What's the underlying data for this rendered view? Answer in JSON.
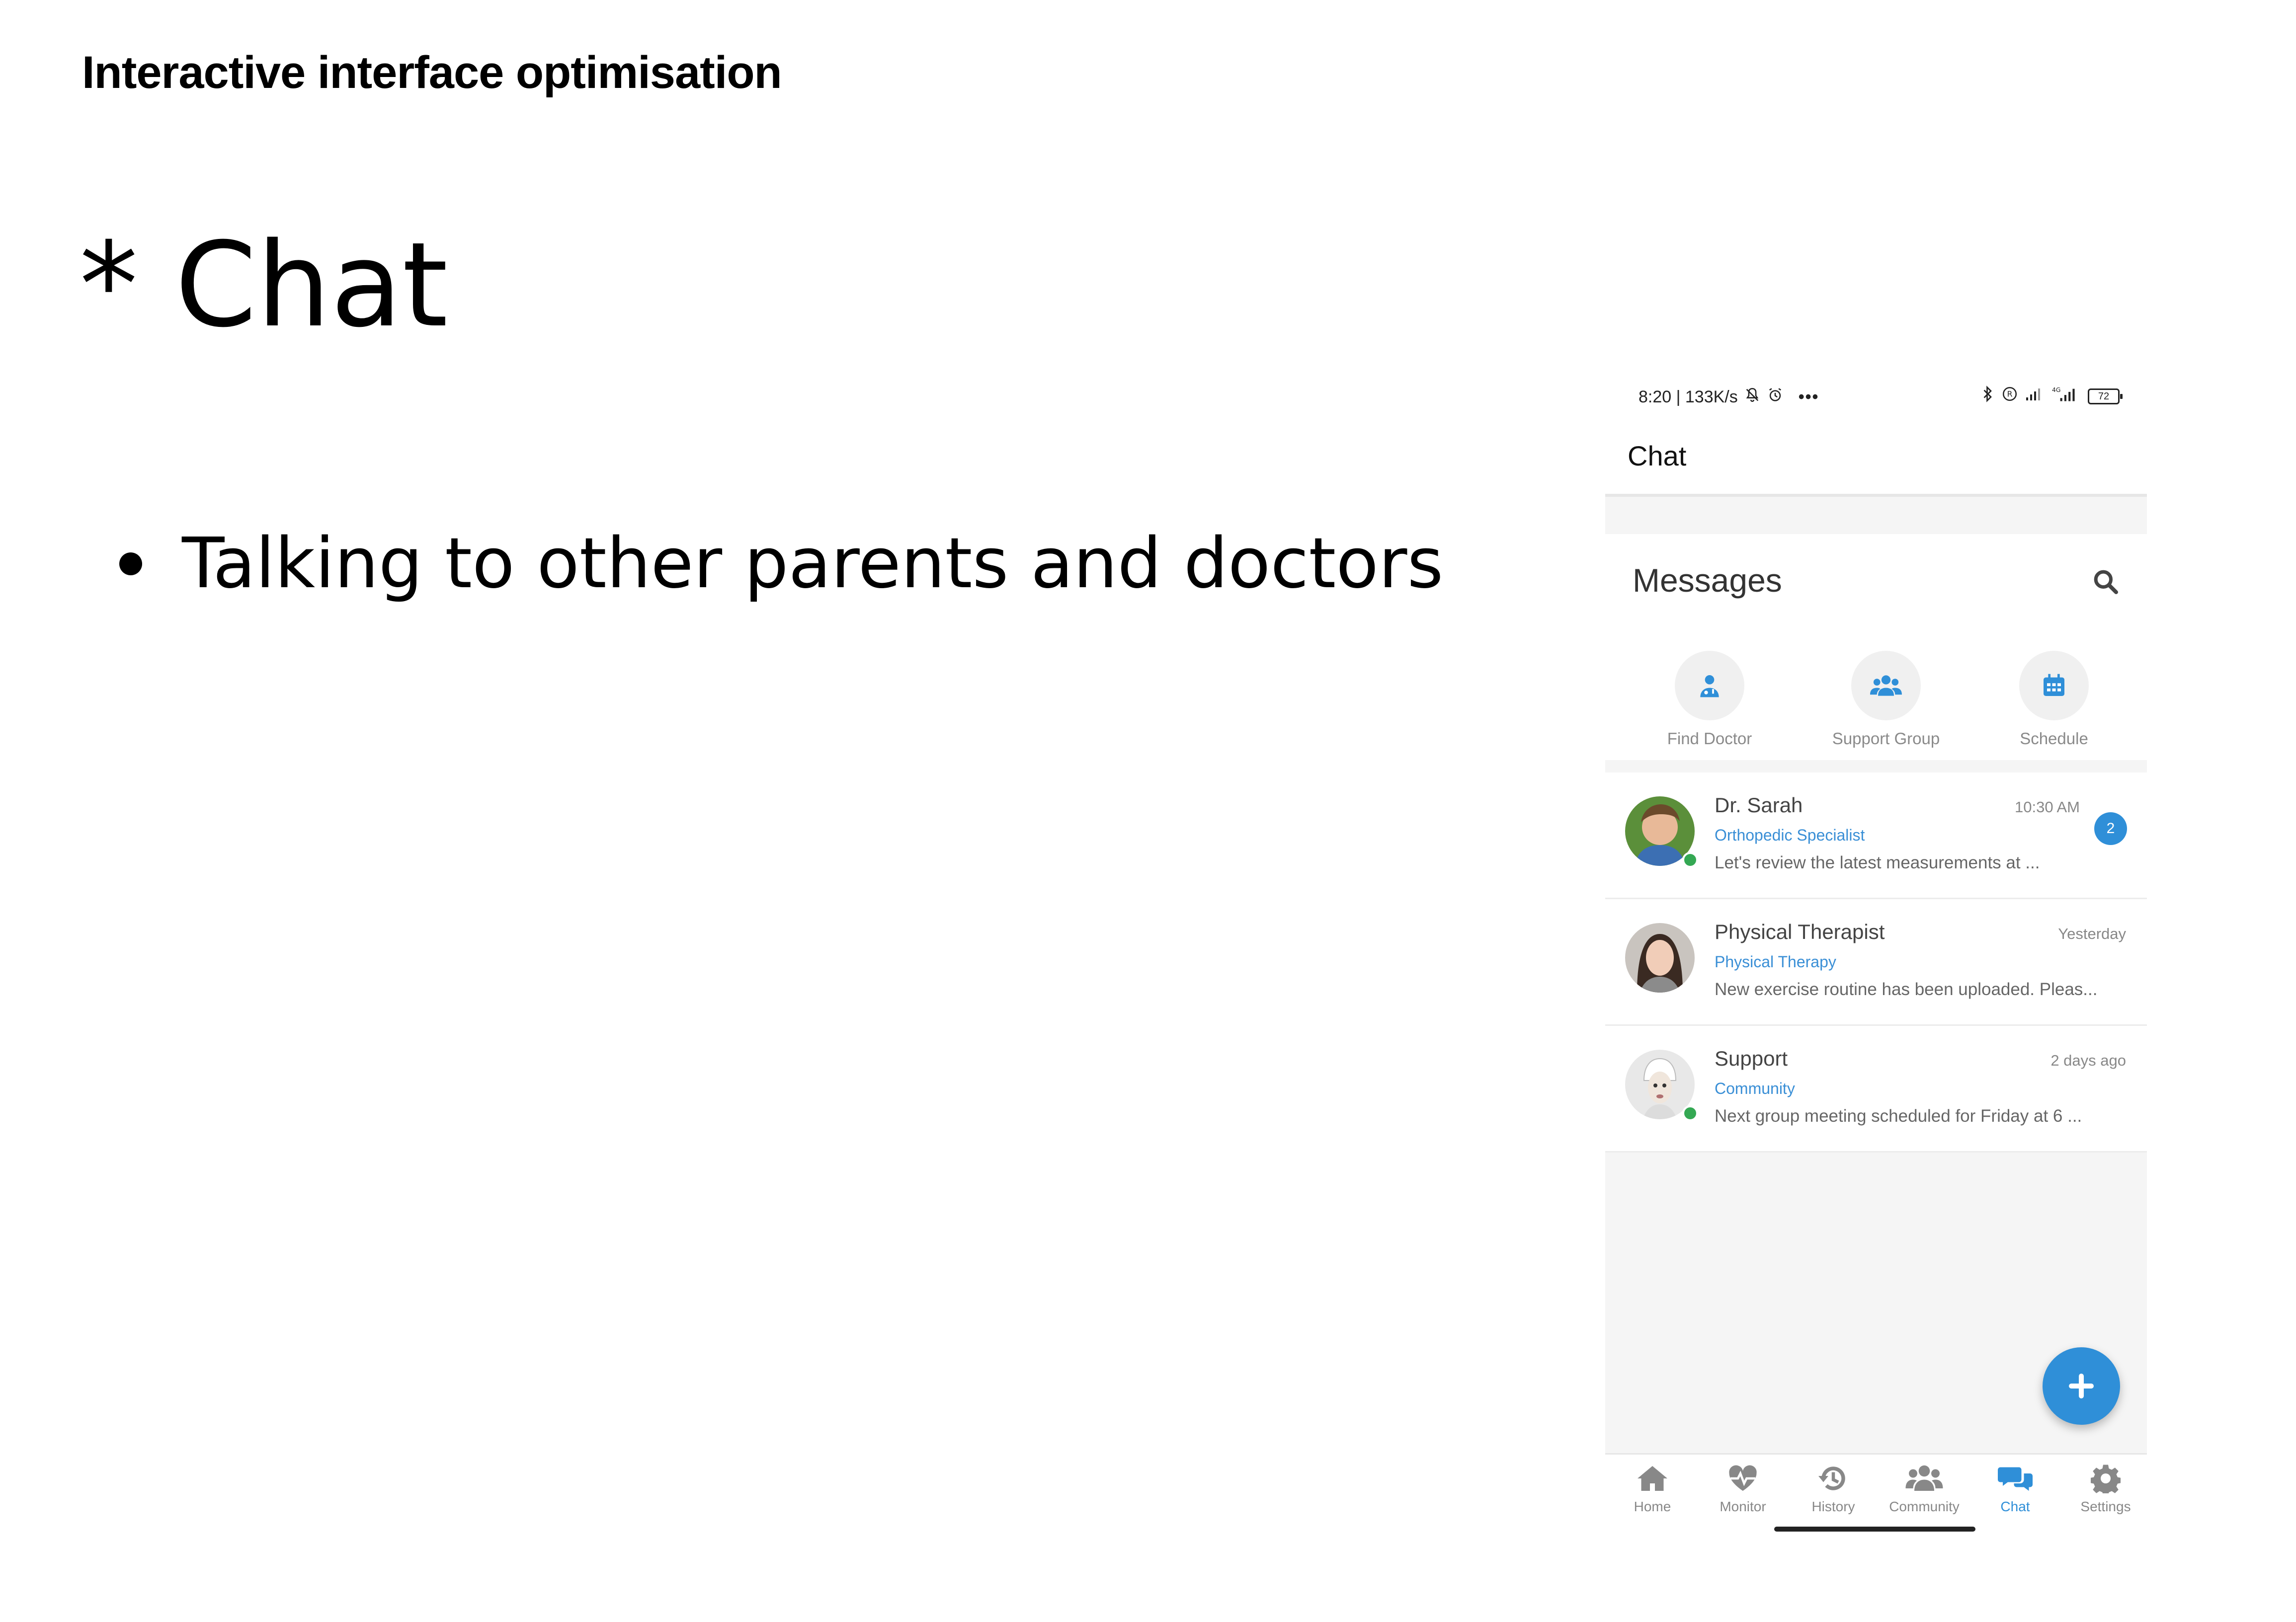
{
  "slide": {
    "title": "Interactive interface optimisation",
    "heading": "* Chat",
    "bullet": "Talking to other parents and doctors"
  },
  "phone": {
    "status": {
      "time_speed": "8:20 | 133K/s",
      "battery": "72"
    },
    "appbar_title": "Chat",
    "messages_title": "Messages",
    "quick_actions": [
      {
        "label": "Find Doctor",
        "icon": "doctor-icon"
      },
      {
        "label": "Support Group",
        "icon": "group-icon"
      },
      {
        "label": "Schedule",
        "icon": "calendar-icon"
      }
    ],
    "chats": [
      {
        "name": "Dr. Sarah",
        "time": "10:30 AM",
        "role": "Orthopedic Specialist",
        "preview": "Let's review the latest measurements at ...",
        "unread": "2",
        "online": true
      },
      {
        "name": "Physical Therapist",
        "time": "Yesterday",
        "role": "Physical Therapy",
        "preview": "New exercise routine has been uploaded. Pleas...",
        "online": false
      },
      {
        "name": "Support",
        "time": "2 days ago",
        "role": "Community",
        "preview": "Next group meeting scheduled for Friday at 6 ...",
        "online": true
      }
    ],
    "nav": [
      {
        "label": "Home",
        "icon": "home-icon"
      },
      {
        "label": "Monitor",
        "icon": "heartbeat-icon"
      },
      {
        "label": "History",
        "icon": "history-icon"
      },
      {
        "label": "Community",
        "icon": "users-icon"
      },
      {
        "label": "Chat",
        "icon": "chat-bubbles-icon",
        "active": true
      },
      {
        "label": "Settings",
        "icon": "gear-icon"
      }
    ],
    "colors": {
      "accent": "#2f8fd8",
      "online": "#34a853",
      "background": "#f5f5f5"
    }
  }
}
